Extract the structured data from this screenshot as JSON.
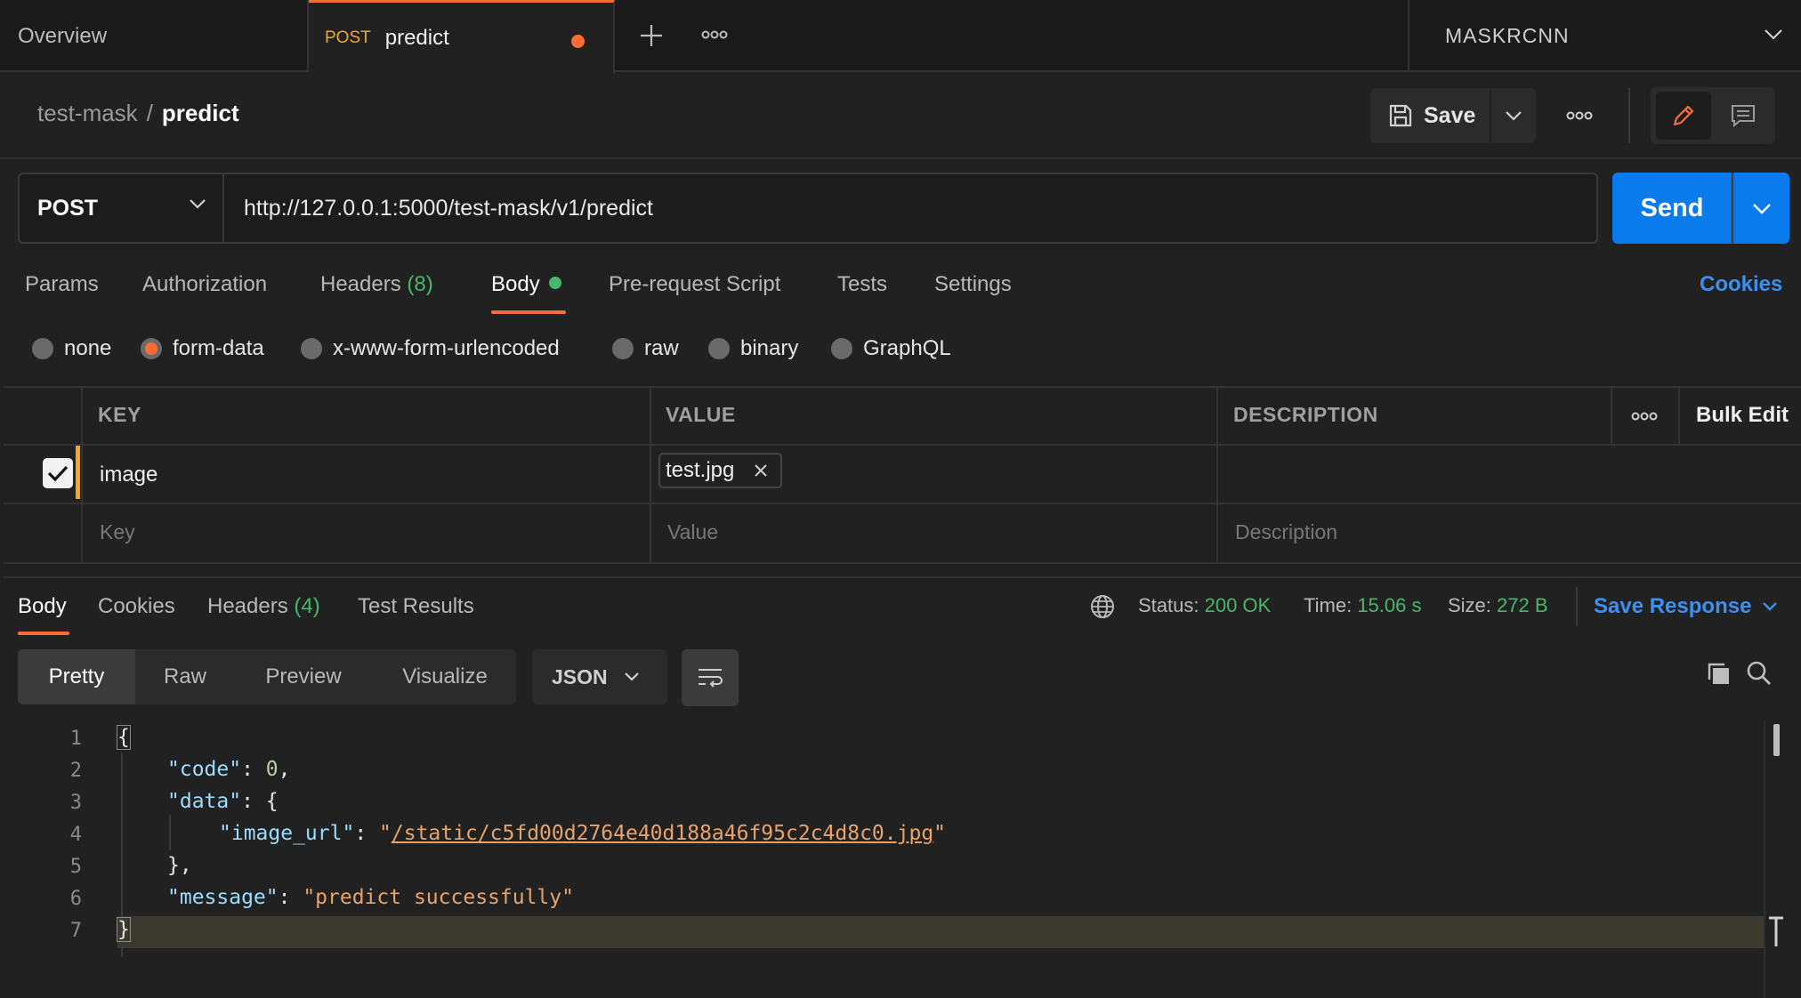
{
  "tabs": {
    "overview": "Overview",
    "active_method": "POST",
    "active_title": "predict"
  },
  "environment": "MASKRCNN",
  "breadcrumb": {
    "parent": "test-mask",
    "separator": "/",
    "current": "predict"
  },
  "toolbar": {
    "save_label": "Save"
  },
  "request": {
    "method": "POST",
    "url": "http://127.0.0.1:5000/test-mask/v1/predict",
    "send_label": "Send"
  },
  "request_tabs": {
    "params": "Params",
    "authorization": "Authorization",
    "headers": "Headers",
    "headers_count": "(8)",
    "body": "Body",
    "pre_request": "Pre-request Script",
    "tests": "Tests",
    "settings": "Settings",
    "cookies": "Cookies"
  },
  "body_types": {
    "none": "none",
    "form_data": "form-data",
    "urlencoded": "x-www-form-urlencoded",
    "raw": "raw",
    "binary": "binary",
    "graphql": "GraphQL",
    "selected": "form-data"
  },
  "params_table": {
    "headers": {
      "key": "KEY",
      "value": "VALUE",
      "description": "DESCRIPTION",
      "bulk_edit": "Bulk Edit"
    },
    "rows": [
      {
        "key": "image",
        "file": "test.jpg",
        "checked": true
      }
    ],
    "placeholders": {
      "key": "Key",
      "value": "Value",
      "description": "Description"
    }
  },
  "response_tabs": {
    "body": "Body",
    "cookies": "Cookies",
    "headers": "Headers",
    "headers_count": "(4)",
    "test_results": "Test Results"
  },
  "response_meta": {
    "status_label": "Status:",
    "status_value": "200 OK",
    "time_label": "Time:",
    "time_value": "15.06 s",
    "size_label": "Size:",
    "size_value": "272 B",
    "save_response": "Save Response"
  },
  "viewer": {
    "modes": [
      "Pretty",
      "Raw",
      "Preview",
      "Visualize"
    ],
    "active_mode": "Pretty",
    "format": "JSON"
  },
  "code": {
    "line_numbers": [
      "1",
      "2",
      "3",
      "4",
      "5",
      "6",
      "7"
    ],
    "open_brace": "{",
    "code_key": "\"code\"",
    "code_val": "0",
    "data_key": "\"data\"",
    "image_url_key": "\"image_url\"",
    "image_url_val": "/static/c5fd00d2764e40d188a46f95c2c4d8c0.jpg",
    "message_key": "\"message\"",
    "message_val": "\"predict successfully\"",
    "close_brace": "}"
  },
  "colors": {
    "accent": "#ff6c37",
    "send": "#097bed",
    "success": "#47b86b",
    "link": "#3d8ff0"
  }
}
